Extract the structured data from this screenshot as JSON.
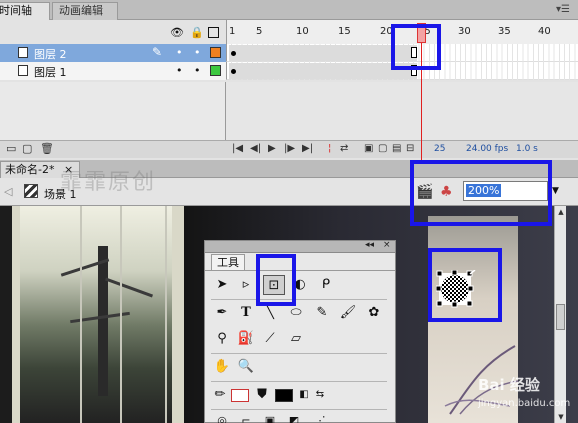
{
  "timeline_panel": {
    "tabs": [
      "时间轴",
      "动画编辑器"
    ],
    "header_icons": [
      "eye-icon",
      "lock-icon",
      "outline-icon"
    ],
    "ruler_numbers": [
      "1",
      "5",
      "10",
      "15",
      "20",
      "25",
      "30",
      "35",
      "40"
    ],
    "layers": [
      {
        "name": "图层 2",
        "color": "#f08020",
        "selected": true
      },
      {
        "name": "图层 1",
        "color": "#3cc840",
        "selected": false
      }
    ],
    "dot": "•",
    "footer": {
      "current_frame": "25",
      "fps": "24.00 fps",
      "time": "1.0 s"
    }
  },
  "document": {
    "tab_label": "未命名-2*",
    "tab_close": "×",
    "scene_label": "场景 1",
    "zoom_value": "200%",
    "watermark": "霏霏原创"
  },
  "tools_panel": {
    "title": "工具",
    "collapse_glyph": "◂◂",
    "close_glyph": "×"
  },
  "branding": {
    "logo": "Bai 经验",
    "url": "jingyan.baidu.com"
  },
  "colors": {
    "highlight": "#1a16e8",
    "playhead": "#e02020",
    "selection_row": "#7fa8dc"
  }
}
